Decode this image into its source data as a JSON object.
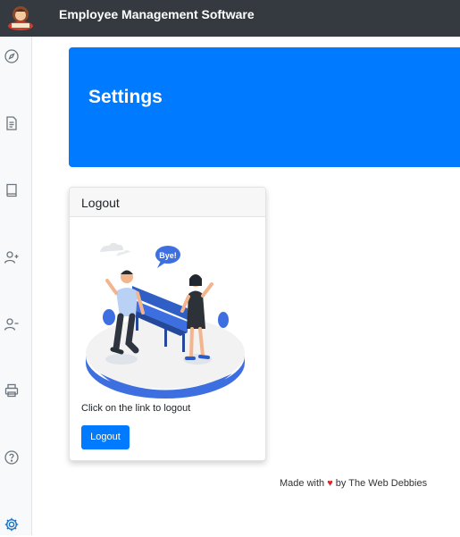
{
  "app": {
    "title": "Employee Management Software"
  },
  "sidebar": {
    "items": [
      {
        "icon": "compass-icon"
      },
      {
        "icon": "document-icon"
      },
      {
        "icon": "book-icon"
      },
      {
        "icon": "add-user-icon"
      },
      {
        "icon": "remove-user-icon"
      },
      {
        "icon": "printer-icon"
      },
      {
        "icon": "help-icon"
      },
      {
        "icon": "gear-icon"
      }
    ]
  },
  "page": {
    "title": "Settings"
  },
  "card": {
    "title": "Logout",
    "bubble": "Bye!",
    "text": "Click on the link to logout",
    "button": "Logout"
  },
  "footer": {
    "before": "Made with",
    "after": "by The Web Debbies"
  },
  "colors": {
    "primary": "#007bff",
    "topbar": "#343a40",
    "active_icon": "#1a73c8",
    "heart": "#e0242c"
  }
}
